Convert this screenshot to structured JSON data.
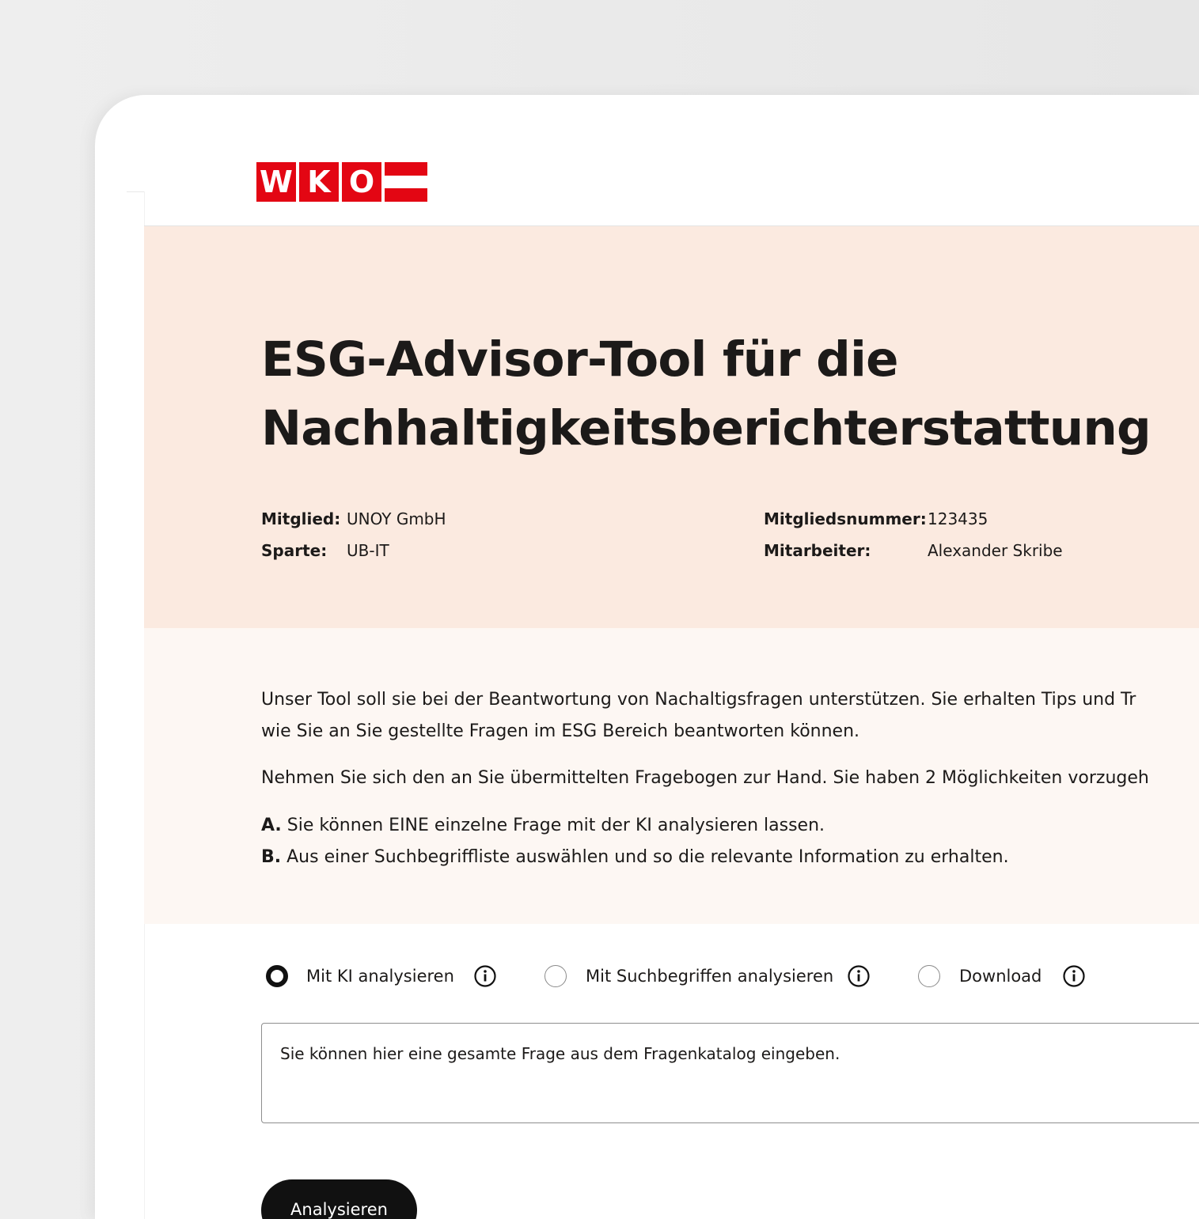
{
  "logo": {
    "letters": [
      "W",
      "K",
      "O"
    ],
    "brand_color": "#e30613"
  },
  "hero": {
    "title_line1": "ESG-Advisor-Tool für die",
    "title_line2": "Nachhaltigkeitsberichterstattung",
    "background_color": "#fbeae0",
    "member_label": "Mitglied:",
    "member_value": "UNOY GmbH",
    "division_label": "Sparte:",
    "division_value": "UB-IT",
    "member_number_label": "Mitgliedsnummer:",
    "member_number_value": "123435",
    "employee_label": "Mitarbeiter:",
    "employee_value": "Alexander Skribe"
  },
  "intro": {
    "paragraph1_line1": "Unser Tool soll sie bei der Beantwortung von Nachaltigsfragen unterstützen. Sie erhalten Tips und Tr",
    "paragraph1_line2": "wie Sie an Sie gestellte Fragen im ESG Bereich beantworten können.",
    "paragraph2": "Nehmen Sie sich den an Sie übermittelten Fragebogen zur Hand. Sie haben 2 Möglichkeiten vorzugeh",
    "option_a_marker": "A.",
    "option_a_text": " Sie können EINE einzelne Frage mit der KI analysieren lassen.",
    "option_b_marker": "B.",
    "option_b_text": " Aus einer Suchbegriffliste auswählen und so die relevante Information zu erhalten."
  },
  "options": {
    "selected": "ki",
    "items": [
      {
        "label": "Mit KI analysieren",
        "checked": true,
        "icon": "info-icon"
      },
      {
        "label": "Mit Suchbegriffen analysieren",
        "checked": false,
        "icon": "info-icon"
      },
      {
        "label": "Download",
        "checked": false,
        "icon": "info-icon"
      }
    ]
  },
  "question_input": {
    "placeholder": "Sie können hier eine gesamte Frage aus dem Fragenkatalog eingeben.",
    "value": ""
  },
  "actions": {
    "analyze_label": "Analysieren"
  }
}
